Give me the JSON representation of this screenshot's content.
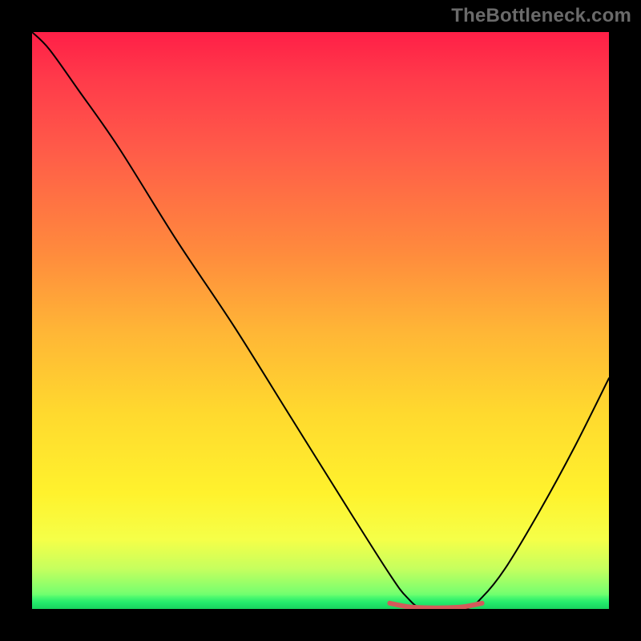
{
  "watermark": "TheBottleneck.com",
  "chart_data": {
    "type": "line",
    "title": "",
    "xlabel": "",
    "ylabel": "",
    "xlim": [
      0,
      100
    ],
    "ylim": [
      0,
      100
    ],
    "grid": false,
    "legend": false,
    "gradient": {
      "direction": "vertical",
      "stops": [
        {
          "pos": 0,
          "color": "#ff1f47"
        },
        {
          "pos": 8,
          "color": "#ff3a4a"
        },
        {
          "pos": 20,
          "color": "#ff5a49"
        },
        {
          "pos": 38,
          "color": "#ff8a3d"
        },
        {
          "pos": 52,
          "color": "#ffb636"
        },
        {
          "pos": 66,
          "color": "#ffd92e"
        },
        {
          "pos": 80,
          "color": "#fff22d"
        },
        {
          "pos": 88,
          "color": "#f5ff48"
        },
        {
          "pos": 93,
          "color": "#c6ff5e"
        },
        {
          "pos": 97,
          "color": "#7cff6e"
        },
        {
          "pos": 100,
          "color": "#2bff74"
        }
      ]
    },
    "series": [
      {
        "name": "bottleneck-curve",
        "color": "#000000",
        "width": 2,
        "x": [
          0,
          3,
          8,
          15,
          25,
          35,
          45,
          55,
          62,
          65,
          68,
          75,
          78,
          82,
          88,
          94,
          100
        ],
        "values": [
          100,
          97,
          90,
          80,
          64,
          49,
          33,
          17,
          6,
          2,
          0,
          0,
          2,
          7,
          17,
          28,
          40
        ]
      },
      {
        "name": "optimal-range-marker",
        "color": "#d45a5a",
        "width": 6,
        "x": [
          62,
          65,
          68,
          72,
          75,
          78
        ],
        "values": [
          1.0,
          0.4,
          0.2,
          0.2,
          0.4,
          1.0
        ]
      }
    ],
    "annotations": []
  }
}
